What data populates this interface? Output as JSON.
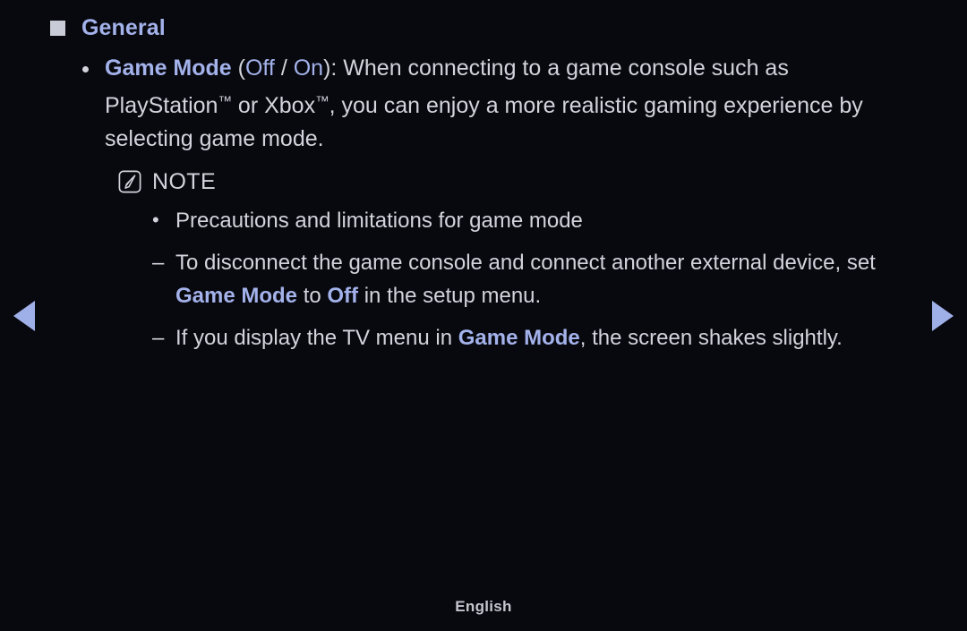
{
  "background_color": "#08080f",
  "accent_color": "#a3b2ea",
  "text_color": "#d2d4dc",
  "nav": {
    "prev_label": "◀",
    "next_label": "▶",
    "prev_icon": "triangle-left-icon",
    "next_icon": "triangle-right-icon"
  },
  "section": {
    "marker_icon": "square-marker-icon",
    "title": "General"
  },
  "game_mode": {
    "bullet_icon": "bullet-dot-icon",
    "term": "Game Mode",
    "paren_open": " (",
    "option_off": "Off",
    "option_sep": " / ",
    "option_on": "On",
    "paren_close": ")",
    "description": ": When connecting to a game console such as PlayStation",
    "tm1": "™",
    "description2": " or Xbox",
    "tm2": "™",
    "description3": ", you can enjoy a more realistic gaming experience by selecting game mode."
  },
  "note": {
    "icon": "note-pencil-icon",
    "label": "NOTE",
    "items": [
      {
        "marker": "•",
        "marker_type": "bullet",
        "marker_icon": "bullet-dot-icon",
        "text": "Precautions and limitations for game mode"
      },
      {
        "marker": "–",
        "marker_type": "dash",
        "marker_icon": "dash-icon",
        "text_1": "To disconnect the game console and connect another external device, set ",
        "em_1": "Game Mode",
        "text_2": " to ",
        "em_2": "Off",
        "text_3": " in the setup menu."
      },
      {
        "marker": "–",
        "marker_type": "dash",
        "marker_icon": "dash-icon",
        "text_1": "If you display the TV menu in ",
        "em_1": "Game Mode",
        "text_2": ", the screen shakes slightly."
      }
    ]
  },
  "footer": {
    "language": "English"
  }
}
